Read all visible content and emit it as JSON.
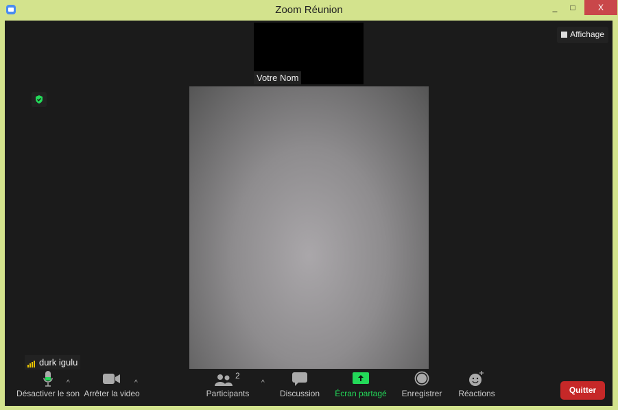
{
  "window": {
    "title": "Zoom Réunion",
    "minimize": "_",
    "maximize": "□",
    "close": "X"
  },
  "view_button": "Affichage",
  "self_view": {
    "name": "Votre Nom"
  },
  "active_speaker": {
    "name": "durk igulu"
  },
  "toolbar": {
    "mute": "Désactiver le son",
    "video": "Arrêter la video",
    "participants": "Participants",
    "participants_count": "2",
    "chat": "Discussion",
    "share": "Écran partagé",
    "record": "Enregistrer",
    "reactions": "Réactions",
    "quit": "Quitter"
  },
  "colors": {
    "accent_green": "#23d959",
    "quit_red": "#c62828",
    "frame": "#d3e38d"
  }
}
